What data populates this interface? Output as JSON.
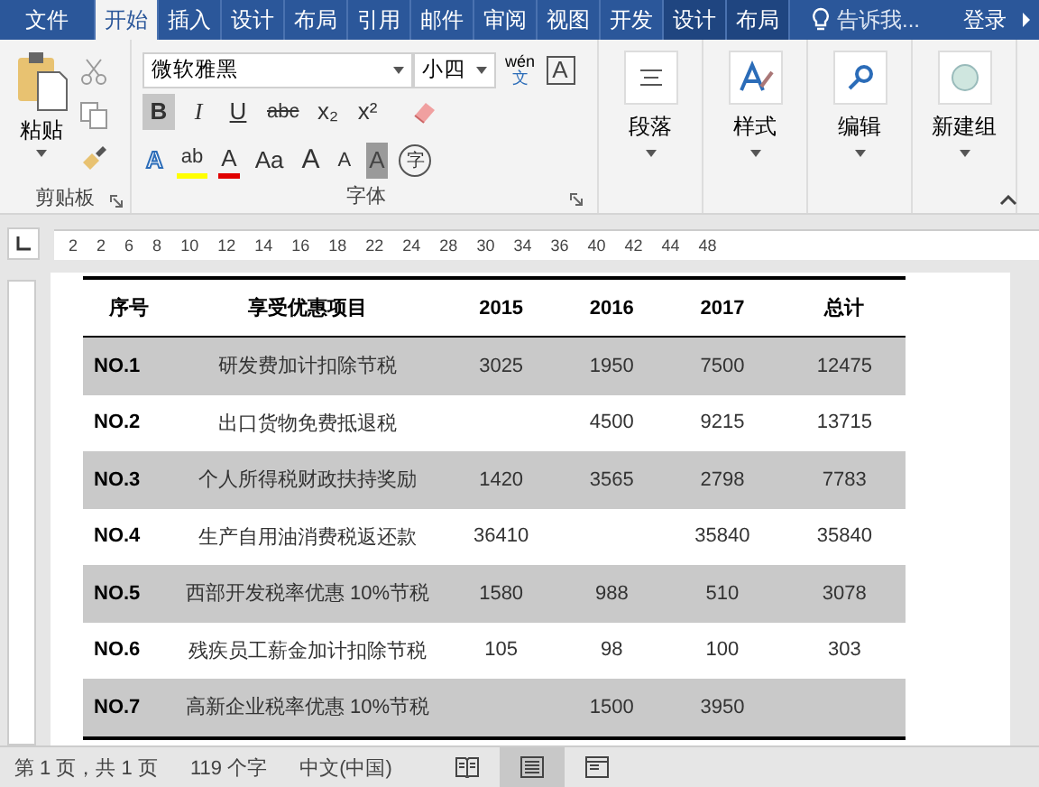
{
  "tabs": [
    {
      "label": "文件",
      "selected": false,
      "contextual": false
    },
    {
      "label": "开始",
      "selected": true,
      "contextual": false
    },
    {
      "label": "插入",
      "selected": false,
      "contextual": false
    },
    {
      "label": "设计",
      "selected": false,
      "contextual": false
    },
    {
      "label": "布局",
      "selected": false,
      "contextual": false
    },
    {
      "label": "引用",
      "selected": false,
      "contextual": false
    },
    {
      "label": "邮件",
      "selected": false,
      "contextual": false
    },
    {
      "label": "审阅",
      "selected": false,
      "contextual": false
    },
    {
      "label": "视图",
      "selected": false,
      "contextual": false
    },
    {
      "label": "开发",
      "selected": false,
      "contextual": false
    },
    {
      "label": "设计",
      "selected": false,
      "contextual": true
    },
    {
      "label": "布局",
      "selected": false,
      "contextual": true
    }
  ],
  "tell_me": {
    "placeholder": "告诉我..."
  },
  "sign_in": "登录",
  "clipboard": {
    "paste": "粘贴",
    "label": "剪贴板"
  },
  "font": {
    "family": "微软雅黑",
    "size": "小四",
    "label": "字体",
    "phonetic_top": "wén",
    "phonetic_bottom": "文",
    "border_char": "A",
    "row2": [
      {
        "label": "B",
        "selected": true,
        "kind": "bold"
      },
      {
        "label": "I",
        "selected": false,
        "kind": "italic"
      },
      {
        "label": "U",
        "selected": false,
        "kind": "underline"
      },
      {
        "label": "abc",
        "selected": false,
        "kind": "strike"
      },
      {
        "label": "x₂",
        "selected": false,
        "kind": "plain"
      },
      {
        "label": "x²",
        "selected": false,
        "kind": "plain"
      }
    ],
    "row3": [
      {
        "label": "A",
        "kind": "effect"
      },
      {
        "label": "ab",
        "kind": "highlight"
      },
      {
        "label": "A",
        "kind": "color"
      },
      {
        "label": "Aa",
        "kind": "plain"
      },
      {
        "label": "A",
        "kind": "grow"
      },
      {
        "label": "A",
        "kind": "shrink"
      },
      {
        "label": "A",
        "kind": "shade"
      },
      {
        "label": "字",
        "kind": "circle"
      }
    ]
  },
  "big_groups": [
    {
      "label": "段落",
      "kind": "paragraph"
    },
    {
      "label": "样式",
      "kind": "styles"
    },
    {
      "label": "编辑",
      "kind": "find"
    },
    {
      "label": "新建组",
      "kind": "circle"
    }
  ],
  "ruler": [
    "2",
    "2",
    "6",
    "8",
    "10",
    "12",
    "14",
    "16",
    "18",
    "22",
    "24",
    "28",
    "30",
    "34",
    "36",
    "40",
    "42",
    "44",
    "48"
  ],
  "table": {
    "columns": [
      "序号",
      "享受优惠项目",
      "2015",
      "2016",
      "2017",
      "总计"
    ],
    "rows": [
      {
        "shaded": true,
        "cells": [
          "NO.1",
          "研发费加计扣除节税",
          "3025",
          "1950",
          "7500",
          "12475"
        ]
      },
      {
        "shaded": false,
        "cells": [
          "NO.2",
          "出口货物免费抵退税",
          null,
          "4500",
          "9215",
          "13715"
        ]
      },
      {
        "shaded": true,
        "cells": [
          "NO.3",
          "个人所得税财政扶持奖励",
          "1420",
          "3565",
          "2798",
          "7783"
        ]
      },
      {
        "shaded": false,
        "cells": [
          "NO.4",
          "生产自用油消费税返还款",
          "36410",
          null,
          "35840",
          "35840"
        ]
      },
      {
        "shaded": true,
        "cells": [
          "NO.5",
          "西部开发税率优惠 10%节税",
          "1580",
          "988",
          "510",
          "3078"
        ]
      },
      {
        "shaded": false,
        "cells": [
          "NO.6",
          "残疾员工薪金加计扣除节税",
          "105",
          "98",
          "100",
          "303"
        ]
      },
      {
        "shaded": true,
        "cells": [
          "NO.7",
          "高新企业税率优惠 10%节税",
          null,
          "1500",
          "3950",
          null
        ]
      }
    ]
  },
  "status": {
    "page": "第 1 页，共 1 页",
    "words": "119 个字",
    "language": "中文(中国)",
    "views": [
      {
        "kind": "read",
        "selected": false
      },
      {
        "kind": "print",
        "selected": true
      },
      {
        "kind": "web",
        "selected": false
      }
    ]
  }
}
